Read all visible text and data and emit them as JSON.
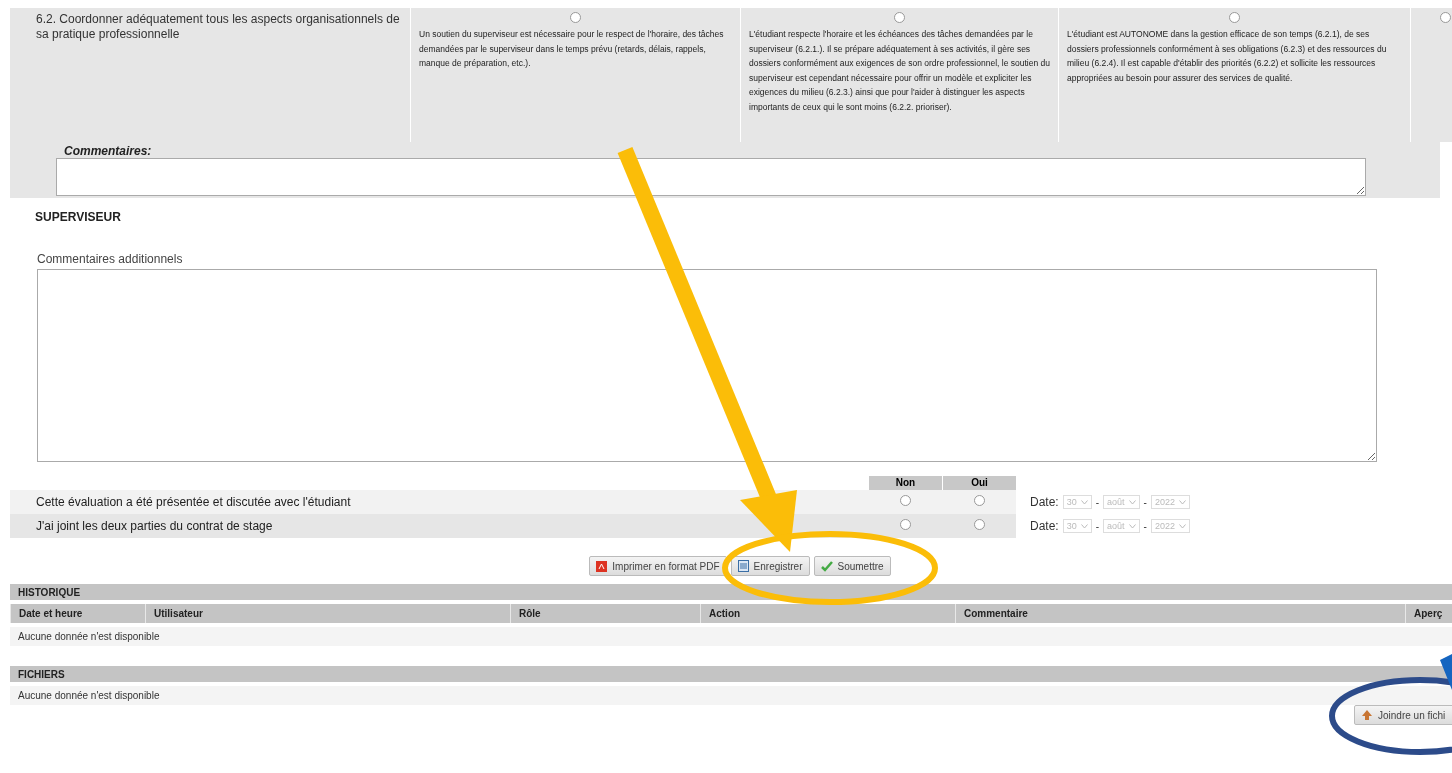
{
  "competency": {
    "label": "6.2. Coordonner adéquatement tous les aspects organisationnels de sa pratique professionnelle",
    "levels": [
      {
        "text": "Un soutien du superviseur est nécessaire pour le respect de l'horaire, des tâches demandées par le superviseur dans le temps prévu (retards, délais, rappels, manque de préparation, etc.).",
        "selected": false
      },
      {
        "text": "L'étudiant respecte l'horaire et les échéances des tâches demandées par le superviseur (6.2.1.). Il se prépare adéquatement à ses activités, il gère ses dossiers conformément aux exigences de son ordre professionnel, le soutien du superviseur est cependant nécessaire pour offrir un modèle et expliciter les exigences du milieu (6.2.3.) ainsi que pour l'aider à distinguer les aspects importants de ceux qui le sont moins (6.2.2. prioriser).",
        "selected": false
      },
      {
        "text": "L'étudiant est AUTONOME dans la gestion efficace de son temps (6.2.1), de ses dossiers professionnels conformément à ses obligations (6.2.3) et des ressources du milieu (6.2.4). Il est capable d'établir des priorités (6.2.2) et sollicite les ressources appropriées au besoin pour assurer des services de qualité.",
        "selected": false
      },
      {
        "selected": false
      }
    ],
    "comments_label": "Commentaires:"
  },
  "supervisor": {
    "title": "SUPERVISEUR",
    "comments_label": "Commentaires additionnels"
  },
  "confirmations": {
    "columns": [
      "Non",
      "Oui"
    ],
    "rows": [
      {
        "label": "Cette évaluation a été présentée et discutée avec l'étudiant",
        "non": false,
        "oui": false,
        "date_label": "Date:",
        "day": "30",
        "month": "août",
        "year": "2022",
        "separators": [
          "-",
          "-"
        ]
      },
      {
        "label": "J'ai joint les deux parties du contrat de stage",
        "non": false,
        "oui": false,
        "date_label": "Date:",
        "day": "30",
        "month": "août",
        "year": "2022",
        "separators": [
          "-",
          "-"
        ]
      }
    ]
  },
  "actions": [
    {
      "kind": "pdf",
      "label": "Imprimer en format PDF"
    },
    {
      "kind": "save",
      "label": "Enregistrer"
    },
    {
      "kind": "submit",
      "label": "Soumettre"
    }
  ],
  "history": {
    "title": "HISTORIQUE",
    "columns": [
      "Date et heure",
      "Utilisateur",
      "Rôle",
      "Action",
      "Commentaire",
      "Aperç"
    ],
    "empty": "Aucune donnée n'est disponible"
  },
  "files": {
    "title": "FICHIERS",
    "empty": "Aucune donnée n'est disponible",
    "attach_button": "Joindre un fichi"
  }
}
